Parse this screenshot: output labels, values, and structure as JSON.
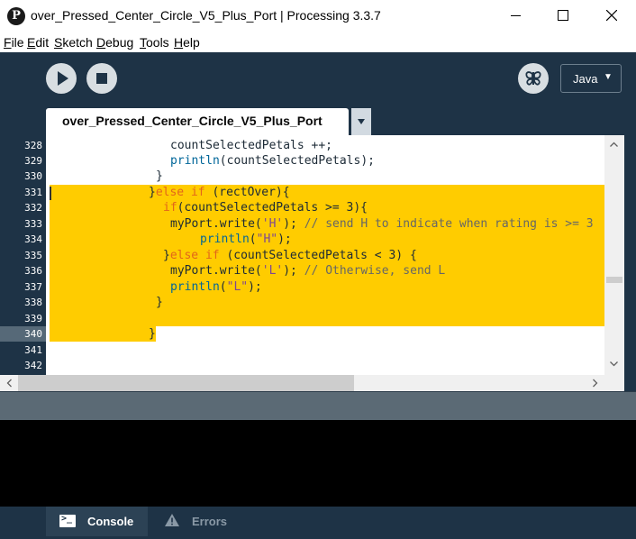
{
  "window": {
    "app_icon_glyph": "P",
    "title": "over_Pressed_Center_Circle_V5_Plus_Port | Processing 3.3.7"
  },
  "menu": [
    {
      "u": "F",
      "rest": "ile"
    },
    {
      "u": "E",
      "rest": "dit"
    },
    {
      "u": "S",
      "rest": "ketch"
    },
    {
      "u": "D",
      "rest": "ebug"
    },
    {
      "u": "T",
      "rest": "ools"
    },
    {
      "u": "H",
      "rest": "elp"
    }
  ],
  "toolbar": {
    "run_icon": "play-icon",
    "stop_icon": "stop-icon",
    "debug_icon": "debugger-butterfly-icon",
    "mode": "Java",
    "mode_caret": "▼"
  },
  "tab": {
    "label": "over_Pressed_Center_Circle_V5_Plus_Port"
  },
  "editor": {
    "current_line": "340",
    "lines": [
      {
        "n": "328"
      },
      {
        "n": "329"
      },
      {
        "n": "330"
      },
      {
        "n": "331"
      },
      {
        "n": "332"
      },
      {
        "n": "333"
      },
      {
        "n": "334"
      },
      {
        "n": "335"
      },
      {
        "n": "336"
      },
      {
        "n": "337"
      },
      {
        "n": "338"
      },
      {
        "n": "339"
      },
      {
        "n": "340"
      },
      {
        "n": "341"
      },
      {
        "n": "342"
      }
    ],
    "code": {
      "l328": "countSelectedPetals ++;",
      "l329_fn": "println",
      "l329_rest": "(countSelectedPetals);",
      "l330": "}",
      "l331_brace": "}",
      "l331_kw": "else if",
      "l331_rest": " (rectOver){",
      "l332_kw": "if",
      "l332_rest": "(countSelectedPetals >= 3){",
      "l333_a": "myPort.write(",
      "l333_str": "'H'",
      "l333_b": "); ",
      "l333_cm": "// send H to indicate when rating is >= 3",
      "l334_fn": "println",
      "l334_a": "(",
      "l334_str": "\"H\"",
      "l334_b": ");",
      "l335_brace": "}",
      "l335_kw": "else if",
      "l335_rest": " (countSelectedPetals < 3) {",
      "l336_a": "myPort.write(",
      "l336_str": "'L'",
      "l336_b": "); ",
      "l336_cm": "// Otherwise, send L",
      "l337_fn": "println",
      "l337_a": "(",
      "l337_str": "\"L\"",
      "l337_b": ");",
      "l338": "}",
      "l340": "}"
    }
  },
  "footer": {
    "console_label": "Console",
    "errors_label": "Errors"
  },
  "colors": {
    "chrome": "#1e3346",
    "highlight": "#ffcc00",
    "keyword": "#e2661a",
    "function": "#006699",
    "string": "#7d4793",
    "comment": "#666666"
  }
}
